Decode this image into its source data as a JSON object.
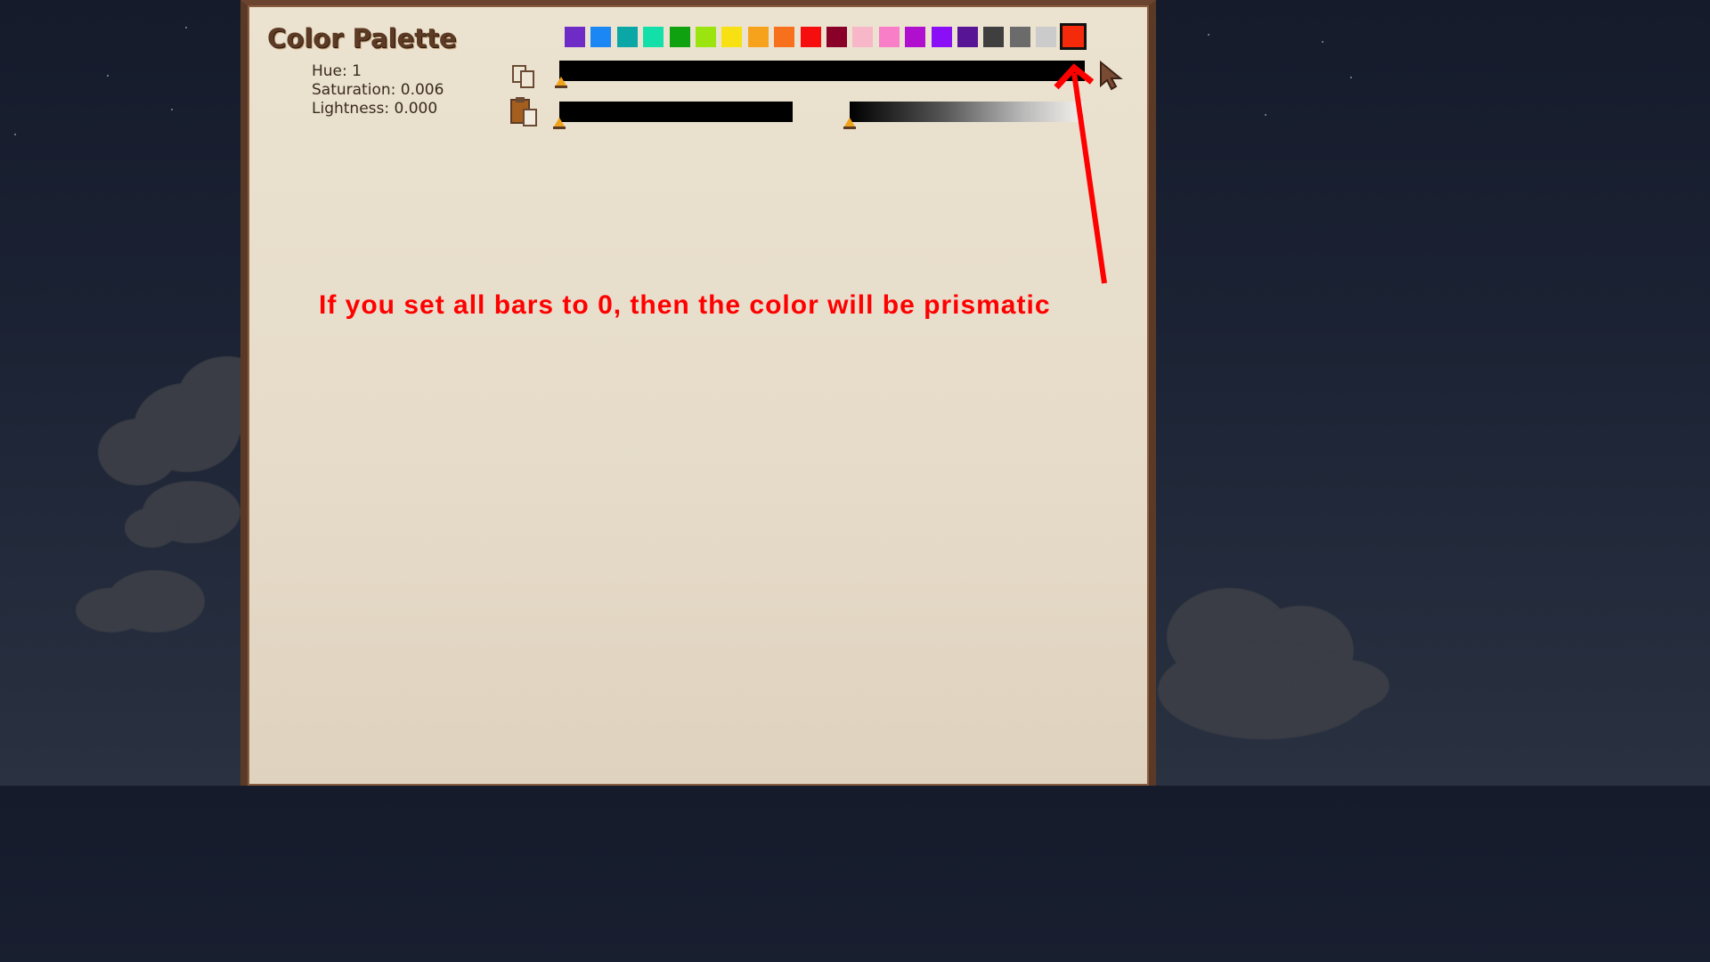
{
  "palette": {
    "title": "Color Palette",
    "hue_text": "Hue: 1",
    "saturation_text": "Saturation: 0.006",
    "lightness_text": "Lightness: 0.000",
    "swatches": [
      "#6e2bc6",
      "#1b87f5",
      "#0aa7a6",
      "#12e0a8",
      "#0fa10f",
      "#9be40f",
      "#f8e112",
      "#f7a21c",
      "#f7701b",
      "#f60e0e",
      "#890028",
      "#f8b7c8",
      "#f77ec7",
      "#b00fcf",
      "#8a0ff7",
      "#571495",
      "#3f3f3f",
      "#6b6b6b",
      "#cbcbcb",
      "#f52a0a"
    ],
    "selected_swatch_index": 19,
    "hue_level": 0.0,
    "saturation_level": 0.0,
    "lightness_level": 0.0
  },
  "annotation": {
    "text": "If you set all bars to 0, then the color will be prismatic",
    "color": "#ff0000"
  },
  "icons": {
    "copy": "copy-icon",
    "paste": "paste-icon",
    "eyedropper": "eyedropper-icon"
  }
}
